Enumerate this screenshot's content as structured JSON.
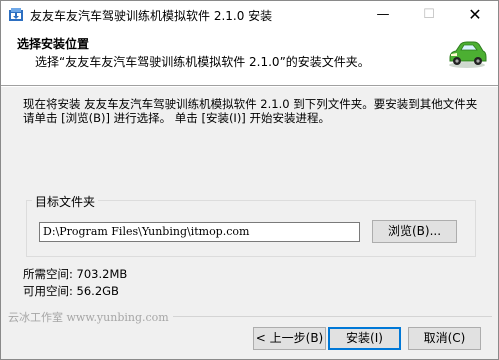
{
  "window": {
    "title": "友友车友汽车驾驶训练机模拟软件 2.1.0 安装",
    "minimize_glyph": "—",
    "maximize_glyph": "☐",
    "close_glyph": "✕"
  },
  "header": {
    "title": "选择安装位置",
    "subtitle": "选择“友友车友汽车驾驶训练机模拟软件 2.1.0”的安装文件夹。",
    "icon": "green-car-icon"
  },
  "intro_text": "现在将安装 友友车友汽车驾驶训练机模拟软件 2.1.0 到下列文件夹。要安装到其他文件夹请单击 [浏览(B)] 进行选择。 单击 [安装(I)] 开始安装进程。",
  "destination": {
    "group_label": "目标文件夹",
    "path_value": "D:\\Program Files\\Yunbing\\itmop.com",
    "browse_label": "浏览(B)..."
  },
  "space": {
    "required_label": "所需空间: 703.2MB",
    "available_label": "可用空间: 56.2GB"
  },
  "brand": "云冰工作室 www.yunbing.com",
  "footer": {
    "back_label": "< 上一步(B)",
    "install_label": "安装(I)",
    "cancel_label": "取消(C)"
  },
  "colors": {
    "accent": "#0078d7",
    "car_body": "#4caf32"
  }
}
